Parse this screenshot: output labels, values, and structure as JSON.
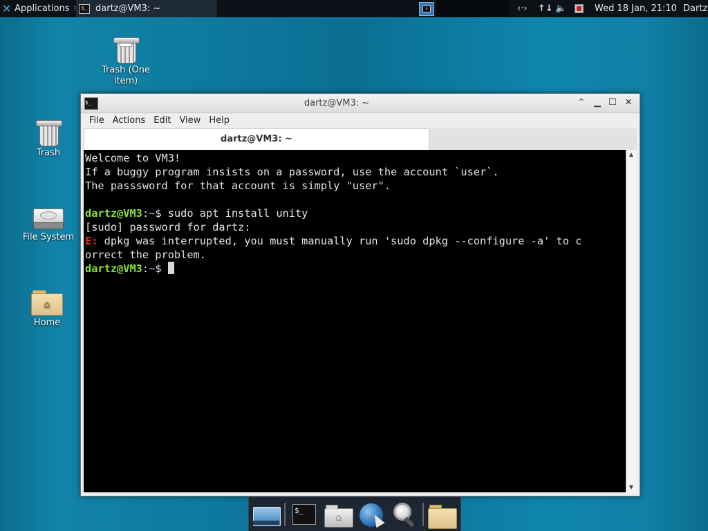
{
  "top_panel": {
    "applications_label": "Applications",
    "task_title": "dartz@VM3: ~",
    "tray_network_icon": "network-icon",
    "tray_transfer_icon": "transfer-arrows-icon",
    "tray_volume_icon": "volume-icon",
    "clock": "Wed 18 Jan, 21:10",
    "user": "Dartz"
  },
  "desktop": {
    "icons": [
      {
        "label": "Trash (One item)"
      },
      {
        "label": "Trash"
      },
      {
        "label": "File System"
      },
      {
        "label": "Home"
      }
    ]
  },
  "window": {
    "title": "dartz@VM3: ~",
    "menu": [
      "File",
      "Actions",
      "Edit",
      "View",
      "Help"
    ],
    "tab_label": "dartz@VM3: ~"
  },
  "terminal": {
    "line1": "Welcome to VM3!",
    "line2": "If a buggy program insists on a password, use the account `user`.",
    "line3": "The passsword for that account is simply \"user\".",
    "prompt_user": "dartz@VM3",
    "prompt_colon": ":",
    "prompt_dir": "~",
    "prompt_sym": "$",
    "command1": " sudo apt install unity",
    "sudo_line": "[sudo] password for dartz:",
    "err_tag": "E:",
    "err_msg": " dpkg was interrupted, you must manually run 'sudo dpkg --configure -a' to c",
    "err_msg2": "orrect the problem."
  },
  "dock": {
    "items": [
      "show-desktop-icon",
      "terminal-icon",
      "home-folder-icon",
      "web-browser-icon",
      "search-icon",
      "folder-icon"
    ]
  }
}
